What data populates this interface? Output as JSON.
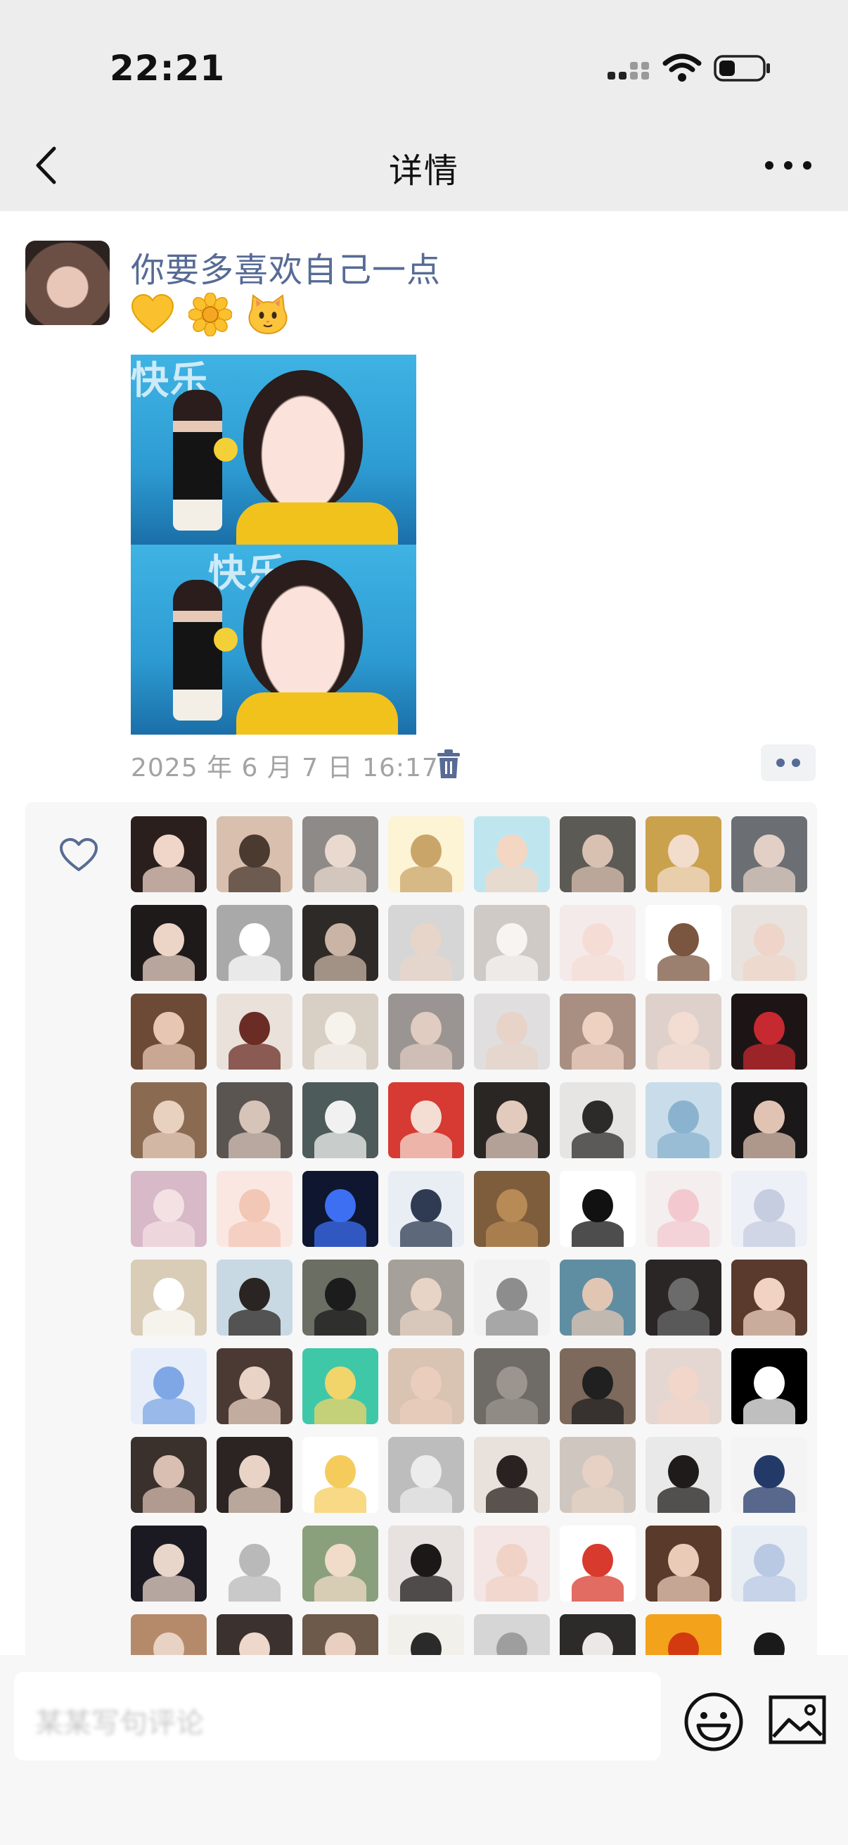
{
  "status_bar": {
    "time": "22:21"
  },
  "nav": {
    "title": "详情"
  },
  "post": {
    "author_name": "你要多喜欢自己一点",
    "emojis": [
      "yellow-heart",
      "sunflower",
      "cat-face"
    ],
    "image_sign_text": "快乐",
    "timestamp": "2025 年 6 月 7 日 16:17"
  },
  "likes": {
    "avatar_colors": [
      [
        "#2a1f1c",
        "#f0d6c8"
      ],
      [
        "#d8bfae",
        "#4a3a30"
      ],
      [
        "#8e8a88",
        "#e9d9cf"
      ],
      [
        "#fdf3d5",
        "#caa56a"
      ],
      [
        "#bfe6ef",
        "#f3d7c3"
      ],
      [
        "#5c5a55",
        "#d9c1b2"
      ],
      [
        "#caa24d",
        "#f2dccb"
      ],
      [
        "#6b6f73",
        "#e2d0c6"
      ],
      [
        "#1f1a1a",
        "#ecd4c7"
      ],
      [
        "#a9a9a9",
        "#ffffff"
      ],
      [
        "#2e2a27",
        "#c9b4a6"
      ],
      [
        "#d6d6d6",
        "#e8d5c9"
      ],
      [
        "#cfcac5",
        "#f7f4f1"
      ],
      [
        "#f3eae9",
        "#f5ddd6"
      ],
      [
        "#ffffff",
        "#7a5540"
      ],
      [
        "#e9e3df",
        "#efd5c9"
      ],
      [
        "#6d4a35",
        "#e7c7b4"
      ],
      [
        "#e9e1da",
        "#6b2c25"
      ],
      [
        "#d8d0c4",
        "#f6f2ec"
      ],
      [
        "#9a9592",
        "#e0ccc0"
      ],
      [
        "#e0dede",
        "#e7d3c8"
      ],
      [
        "#a88f82",
        "#efd1c1"
      ],
      [
        "#ded1cb",
        "#f3dcd1"
      ],
      [
        "#1d1515",
        "#c62930"
      ],
      [
        "#8a6b52",
        "#e9d1c0"
      ],
      [
        "#5b5552",
        "#d7c4b9"
      ],
      [
        "#4d5b5a",
        "#f1f1f1"
      ],
      [
        "#d63a32",
        "#f4ddd2"
      ],
      [
        "#2a2624",
        "#e2cbbd"
      ],
      [
        "#e7e5e3",
        "#2d2b2a"
      ],
      [
        "#c9dcea",
        "#8ab3cf"
      ],
      [
        "#1a1818",
        "#e0c3b2"
      ],
      [
        "#d7b9c8",
        "#f4e1e4"
      ],
      [
        "#fbe7e2",
        "#f3c7b5"
      ],
      [
        "#0e1630",
        "#3d6ff2"
      ],
      [
        "#e8eef3",
        "#2f3b52"
      ],
      [
        "#7d5d3c",
        "#b88a56"
      ],
      [
        "#ffffff",
        "#111111"
      ],
      [
        "#f4eeee",
        "#f3c9cf"
      ],
      [
        "#eef0f7",
        "#c7cde0"
      ],
      [
        "#d9cdb8",
        "#ffffff"
      ],
      [
        "#c9d9e3",
        "#2a2522"
      ],
      [
        "#6a6e63",
        "#1c1c1c"
      ],
      [
        "#a6a09a",
        "#e8d4c6"
      ],
      [
        "#f2f2f2",
        "#8d8d8d"
      ],
      [
        "#5f8ea3",
        "#e2c6b4"
      ],
      [
        "#2a2625",
        "#6b6b6b"
      ],
      [
        "#5a3a2d",
        "#f0d3c3"
      ],
      [
        "#e7eef9",
        "#7fa7e6"
      ],
      [
        "#4b3a33",
        "#e9d3c6"
      ],
      [
        "#3fc8a8",
        "#f1d46a"
      ],
      [
        "#d9c3b2",
        "#eacdbd"
      ],
      [
        "#6f6b67",
        "#9c958f"
      ],
      [
        "#7d6a5c",
        "#202020"
      ],
      [
        "#e4d7d2",
        "#f1d6c9"
      ],
      [
        "#000000",
        "#ffffff"
      ],
      [
        "#3a302c",
        "#d9bfb1"
      ],
      [
        "#2b2422",
        "#e9d3c6"
      ],
      [
        "#ffffff",
        "#f5cc5c"
      ],
      [
        "#bdbdbd",
        "#ececec"
      ],
      [
        "#e8e1dc",
        "#2a2220"
      ],
      [
        "#cfc6c0",
        "#e6d1c4"
      ],
      [
        "#e9e9e9",
        "#1f1b1b"
      ],
      [
        "#f4f4f4",
        "#233a69"
      ],
      [
        "#1b1a22",
        "#e9d6cb"
      ],
      [
        "#f7f7f7",
        "#b9b9b9"
      ],
      [
        "#8aa07c",
        "#f0dcc8"
      ],
      [
        "#e7e2df",
        "#1c1818"
      ],
      [
        "#f3e6e4",
        "#f0d2c6"
      ],
      [
        "#ffffff",
        "#d83a2d"
      ],
      [
        "#5a3b2b",
        "#e9cbb8"
      ],
      [
        "#e9eef5",
        "#b9c9e3"
      ],
      [
        "#b58a6a",
        "#e7d2c4"
      ],
      [
        "#3b3230",
        "#eed8cb"
      ],
      [
        "#6d5a4a",
        "#e9cfc0"
      ],
      [
        "#f2f0ea",
        "#2a2a2a"
      ],
      [
        "#d6d6d6",
        "#9e9e9e"
      ],
      [
        "#2d2a2a",
        "#ece8e6"
      ],
      [
        "#f2a21b",
        "#d43a0f"
      ],
      [
        "#f7f7f7",
        "#1a1a1a"
      ]
    ]
  },
  "composer": {
    "input_value": "某某写句评论"
  }
}
